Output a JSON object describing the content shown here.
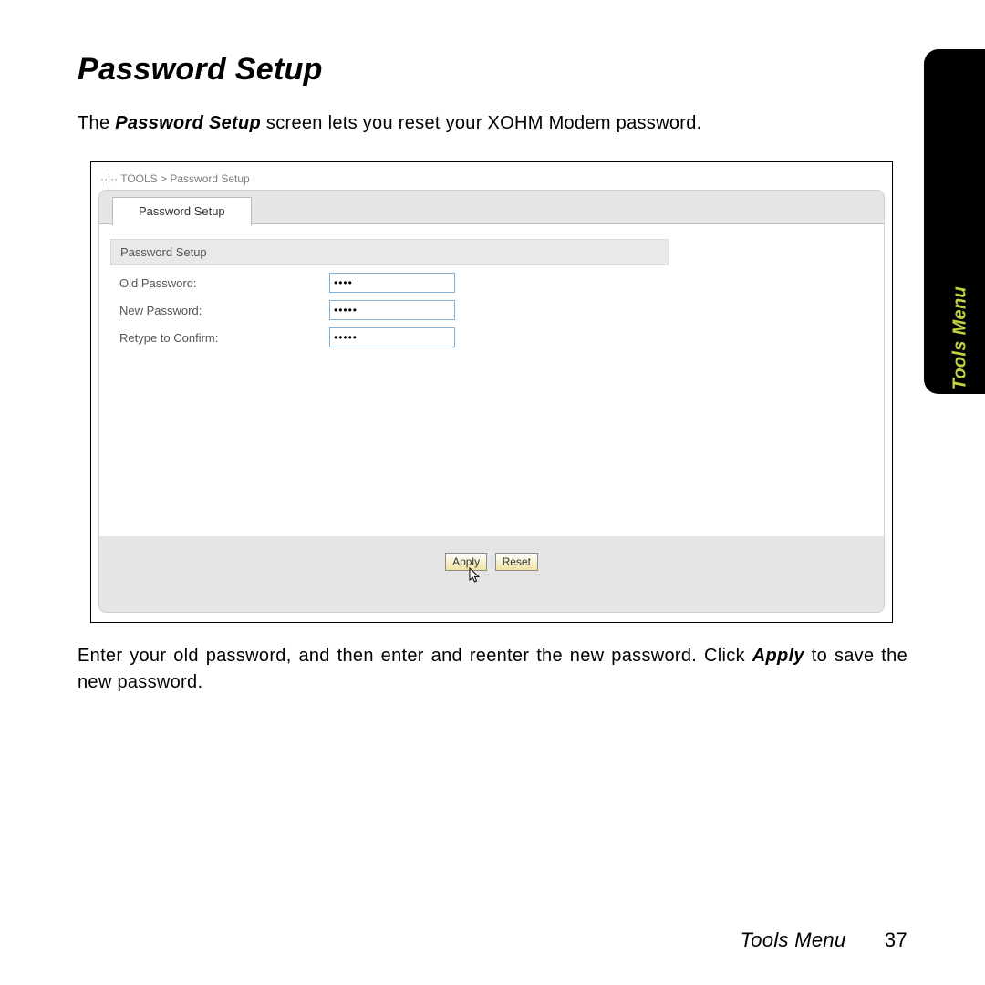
{
  "heading": "Password Setup",
  "intro_prefix": "The ",
  "intro_bold": "Password Setup",
  "intro_suffix": " screen lets you reset your XOHM Modem password.",
  "side_tab": "Tools Menu",
  "shot": {
    "breadcrumb": "··|·· TOOLS > Password Setup",
    "tab_label": "Password Setup",
    "section_title": "Password Setup",
    "fields": {
      "old": {
        "label": "Old Password:",
        "value": "aaaa"
      },
      "new": {
        "label": "New Password:",
        "value": "aaaaa"
      },
      "retype": {
        "label": "Retype to Confirm:",
        "value": "aaaaa"
      }
    },
    "buttons": {
      "apply": "Apply",
      "reset": "Reset"
    }
  },
  "outro_prefix": "Enter your old password, and then enter and reenter the new password. Click ",
  "outro_bold": "Apply",
  "outro_suffix": " to save the new password.",
  "footer": {
    "section": "Tools Menu",
    "page": "37"
  }
}
